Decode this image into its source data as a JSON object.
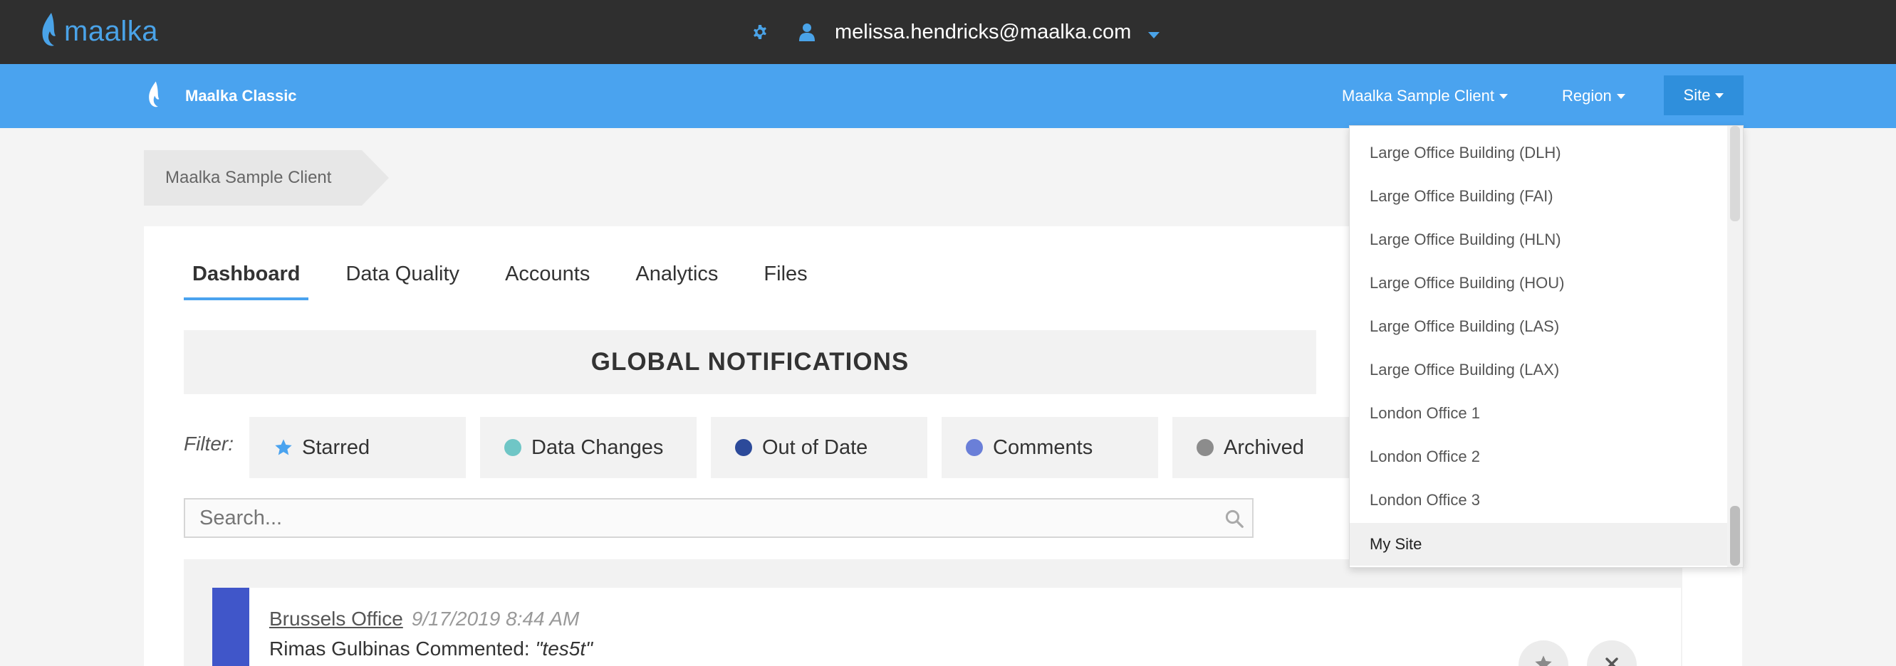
{
  "topbar": {
    "logo_text": "maalka",
    "user_email": "melissa.hendricks@maalka.com"
  },
  "navbar": {
    "brand": "Maalka Classic",
    "client_menu": "Maalka Sample Client",
    "region_menu": "Region",
    "site_menu": "Site"
  },
  "breadcrumb": {
    "label": "Maalka Sample Client"
  },
  "tabs": [
    {
      "label": "Dashboard",
      "active": true
    },
    {
      "label": "Data Quality"
    },
    {
      "label": "Accounts"
    },
    {
      "label": "Analytics"
    },
    {
      "label": "Files"
    }
  ],
  "notifications": {
    "title": "GLOBAL NOTIFICATIONS",
    "filter_label": "Filter:",
    "filters": [
      {
        "label": "Starred",
        "icon": "star-icon",
        "color": "#4aa3ef"
      },
      {
        "label": "Data Changes",
        "icon": "dot",
        "color": "#6fc6c6"
      },
      {
        "label": "Out of Date",
        "icon": "dot",
        "color": "#2c4a9a"
      },
      {
        "label": "Comments",
        "icon": "dot",
        "color": "#6a7fd8"
      },
      {
        "label": "Archived",
        "icon": "dot",
        "color": "#8c8c8c"
      }
    ],
    "search_placeholder": "Search...",
    "items": [
      {
        "site": "Brussels Office",
        "time": "9/17/2019 8:44 AM",
        "text_prefix": "Rimas Gulbinas Commented: ",
        "comment": "\"tes5t\"",
        "color": "#4056c9"
      }
    ]
  },
  "site_dropdown": {
    "items": [
      "Large Office Building (DLH)",
      "Large Office Building (FAI)",
      "Large Office Building (HLN)",
      "Large Office Building (HOU)",
      "Large Office Building (LAS)",
      "Large Office Building (LAX)",
      "London Office 1",
      "London Office 2",
      "London Office 3",
      "My Site"
    ],
    "selected": "My Site"
  }
}
